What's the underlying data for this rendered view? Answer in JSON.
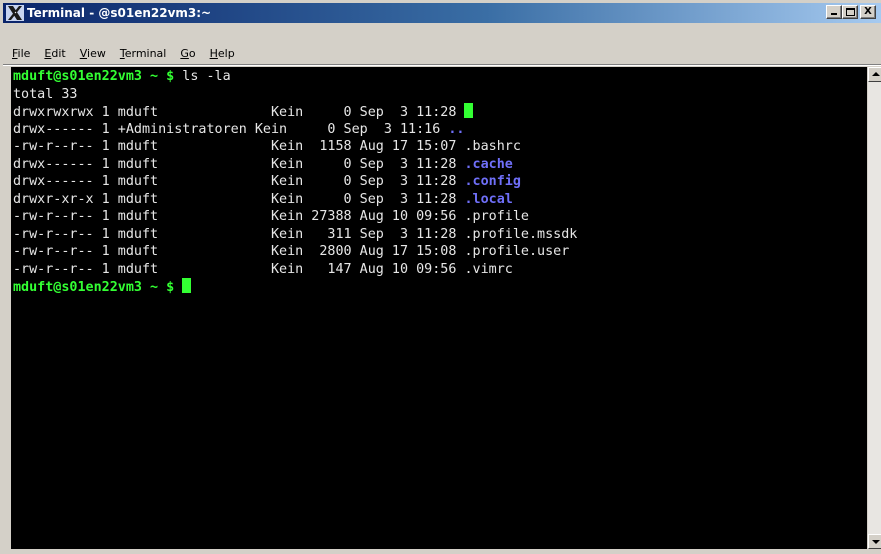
{
  "window": {
    "title": "Terminal - @s01en22vm3:~",
    "buttons": {
      "minimize": "_",
      "maximize": "□",
      "close": "X"
    }
  },
  "menu": [
    {
      "label": "File"
    },
    {
      "label": "Edit"
    },
    {
      "label": "View"
    },
    {
      "label": "Terminal"
    },
    {
      "label": "Go"
    },
    {
      "label": "Help"
    }
  ],
  "terminal": {
    "prompt": "mduft@s01en22vm3 ~ $",
    "command": " ls -la",
    "total": "total 33",
    "entries": [
      {
        "meta": "drwxrwxrwx 1 mduft              Kein     0 Sep  3 11:28 ",
        "name": "",
        "cursor": true,
        "style": "plain"
      },
      {
        "meta": "drwx------ 1 +Administratoren Kein     0 Sep  3 11:16 ",
        "name": "..",
        "style": "dir"
      },
      {
        "meta": "-rw-r--r-- 1 mduft              Kein  1158 Aug 17 15:07 ",
        "name": ".bashrc",
        "style": "plain"
      },
      {
        "meta": "drwx------ 1 mduft              Kein     0 Sep  3 11:28 ",
        "name": ".cache",
        "style": "dir"
      },
      {
        "meta": "drwx------ 1 mduft              Kein     0 Sep  3 11:28 ",
        "name": ".config",
        "style": "dir"
      },
      {
        "meta": "drwxr-xr-x 1 mduft              Kein     0 Sep  3 11:28 ",
        "name": ".local",
        "style": "dir"
      },
      {
        "meta": "-rw-r--r-- 1 mduft              Kein 27388 Aug 10 09:56 ",
        "name": ".profile",
        "style": "plain"
      },
      {
        "meta": "-rw-r--r-- 1 mduft              Kein   311 Sep  3 11:28 ",
        "name": ".profile.mssdk",
        "style": "plain"
      },
      {
        "meta": "-rw-r--r-- 1 mduft              Kein  2800 Aug 17 15:08 ",
        "name": ".profile.user",
        "style": "plain"
      },
      {
        "meta": "-rw-r--r-- 1 mduft              Kein   147 Aug 10 09:56 ",
        "name": ".vimrc",
        "style": "plain"
      }
    ],
    "final_prompt": "mduft@s01en22vm3 ~ $"
  },
  "colors": {
    "prompt": "#33ff33",
    "directory": "#6f6ff8",
    "text": "#e6e6e6",
    "background": "#000000"
  }
}
